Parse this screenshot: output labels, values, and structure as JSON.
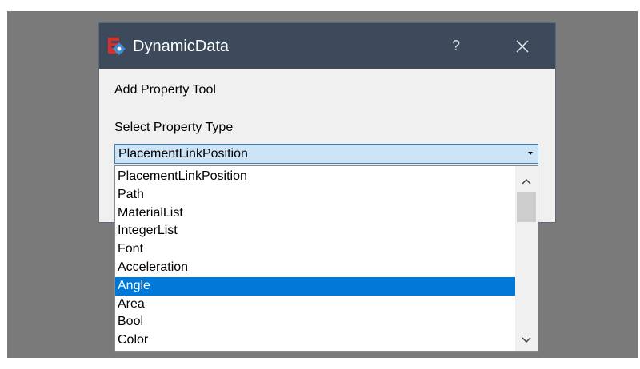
{
  "window": {
    "title": "DynamicData",
    "help_label": "?",
    "icon": "freecad-gear-icon",
    "close_icon": "close-icon"
  },
  "dialog": {
    "heading": "Add Property Tool",
    "select_label": "Select Property Type"
  },
  "combo": {
    "selected_value": "PlacementLinkPosition"
  },
  "dropdown": {
    "items": [
      "PlacementLinkPosition",
      "Path",
      "MaterialList",
      "IntegerList",
      "Font",
      "Acceleration",
      "Angle",
      "Area",
      "Bool",
      "Color"
    ],
    "highlighted": "Angle"
  },
  "colors": {
    "titlebar": "#3c4a5c",
    "selection": "#0078d7",
    "combo_bg": "#cce4f7"
  }
}
